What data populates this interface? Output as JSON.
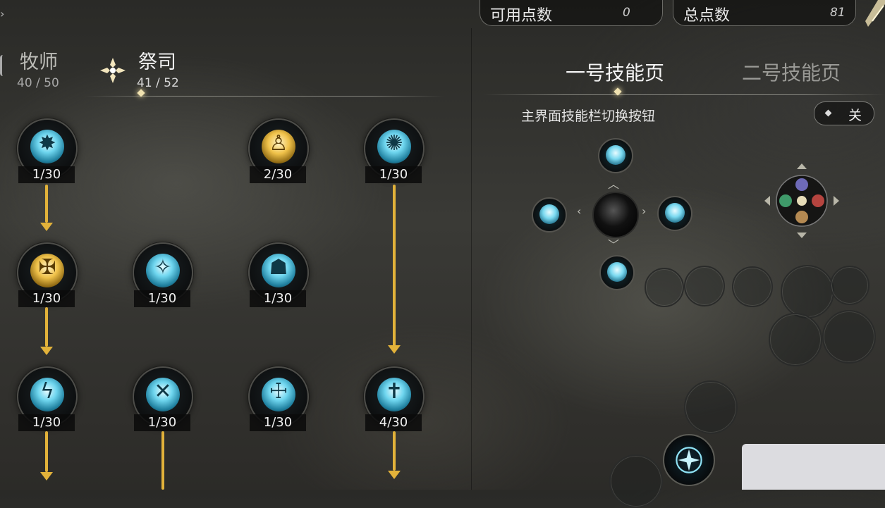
{
  "top_bar": {
    "available_points_label": "可用点数",
    "available_points_value": "0",
    "total_points_label": "总点数",
    "total_points_value": "81"
  },
  "classes": [
    {
      "name": "牧师",
      "count": "40 / 50"
    },
    {
      "name": "祭司",
      "count": "41 / 52"
    }
  ],
  "skill_nodes": [
    {
      "level": "1/30",
      "icon": "burst-icon"
    },
    {
      "level": "2/30",
      "icon": "bulb-icon"
    },
    {
      "level": "1/30",
      "icon": "radiant-orb-icon"
    },
    {
      "level": "1/30",
      "icon": "golden-shield-icon"
    },
    {
      "level": "1/30",
      "icon": "blessing-icon"
    },
    {
      "level": "1/30",
      "icon": "guardian-icon"
    },
    {
      "level": "1/30",
      "icon": "lightning-icon"
    },
    {
      "level": "1/30",
      "icon": "cross-slash-icon"
    },
    {
      "level": "1/30",
      "icon": "holy-guard-icon"
    },
    {
      "level": "4/30",
      "icon": "tombstone-cross-icon"
    }
  ],
  "skill_pages": {
    "page1": "一号技能页",
    "page2": "二号技能页"
  },
  "toggle": {
    "label": "主界面技能栏切换按钮",
    "state": "关"
  },
  "colors": {
    "accent_gold": "#e2b23a",
    "skill_cyan": "#6fd6ef"
  }
}
